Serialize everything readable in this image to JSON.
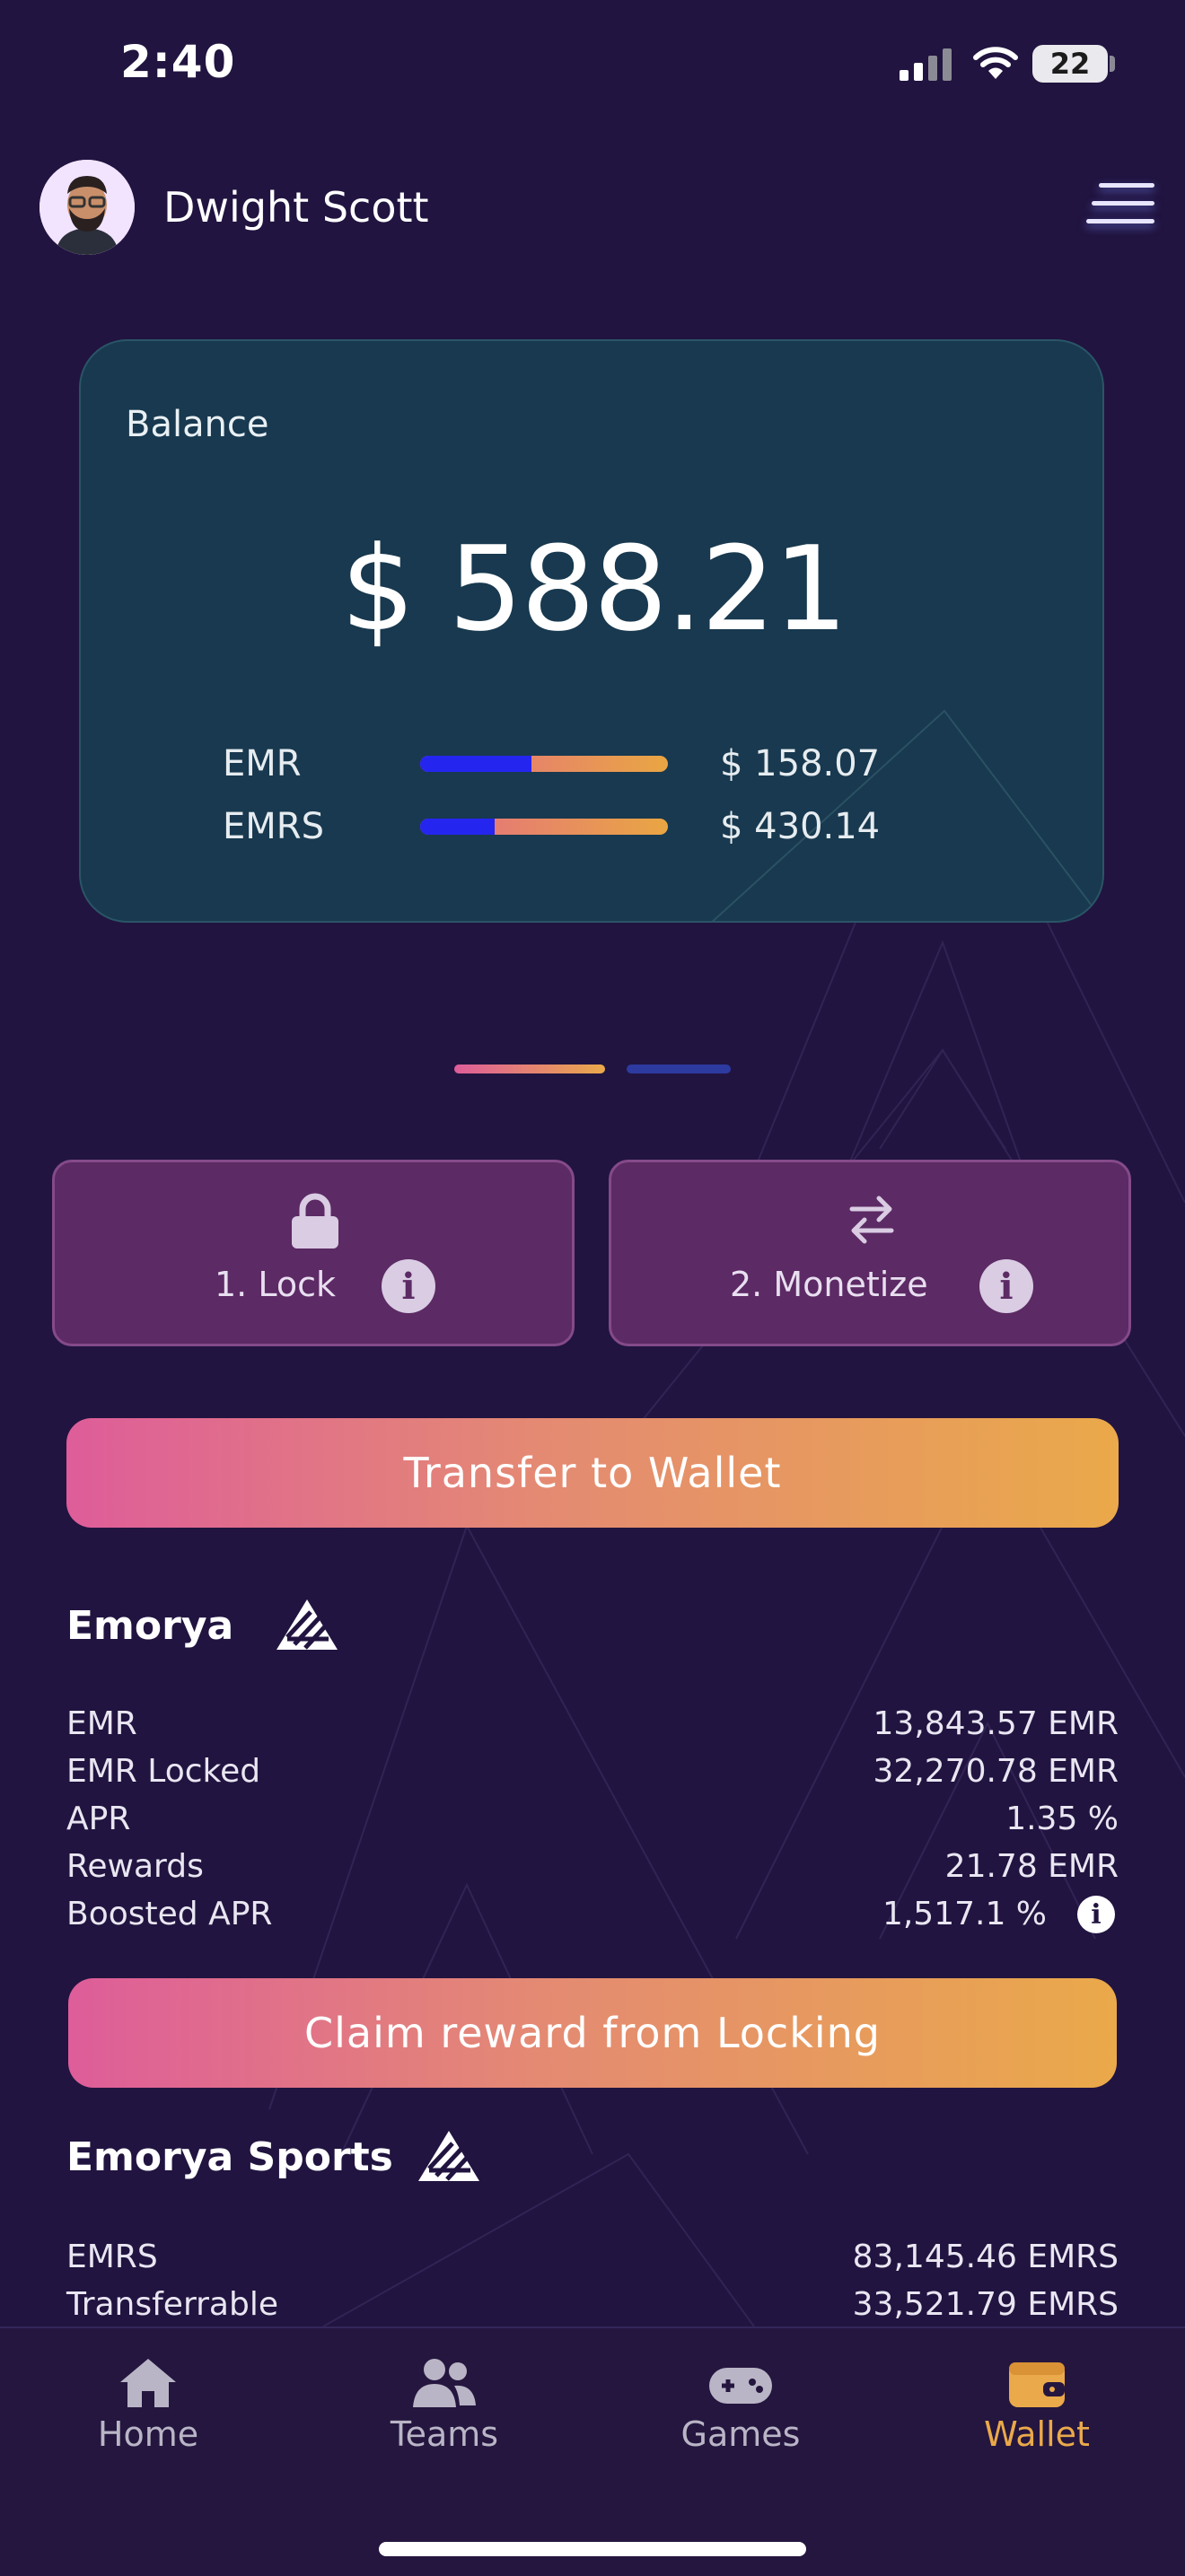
{
  "status_bar": {
    "time": "2:40",
    "battery": "22"
  },
  "header": {
    "user_name": "Dwight Scott"
  },
  "balance": {
    "title": "Balance",
    "amount": "$ 588.21",
    "assets": [
      {
        "label": "EMR",
        "value": "$ 158.07",
        "fill": 0.45
      },
      {
        "label": "EMRS",
        "value": "$ 430.14",
        "fill": 0.3
      }
    ]
  },
  "pager": {
    "count": 2,
    "active_index": 0
  },
  "actions": [
    {
      "label": "1. Lock",
      "icon": "lock-icon"
    },
    {
      "label": "2. Monetize",
      "icon": "swap-arrows-icon"
    }
  ],
  "transfer_button": "Transfer to Wallet",
  "emorya": {
    "title": "Emorya",
    "rows": [
      {
        "label": "EMR",
        "value": "13,843.57 EMR"
      },
      {
        "label": "EMR Locked",
        "value": "32,270.78 EMR"
      },
      {
        "label": "APR",
        "value": "1.35 %"
      },
      {
        "label": "Rewards",
        "value": "21.78 EMR"
      },
      {
        "label": "Boosted APR",
        "value": "1,517.1 %"
      }
    ]
  },
  "claim_button": "Claim reward from Locking",
  "emorya_sports": {
    "title": "Emorya Sports",
    "rows": [
      {
        "label": "EMRS",
        "value": "83,145.46 EMRS"
      },
      {
        "label": "Transferrable",
        "value": "33,521.79 EMRS"
      }
    ]
  },
  "nav": [
    {
      "label": "Home",
      "icon": "home-icon",
      "active": false
    },
    {
      "label": "Teams",
      "icon": "teams-icon",
      "active": false
    },
    {
      "label": "Games",
      "icon": "gamepad-icon",
      "active": false
    },
    {
      "label": "Wallet",
      "icon": "wallet-icon",
      "active": true
    }
  ],
  "colors": {
    "background": "#211440",
    "card": "#18394f",
    "accent_pink": "#de5d9a",
    "accent_orange": "#eaa94a",
    "action_box": "#5c2a64",
    "bar_blue": "#2525f0",
    "active_nav": "#eaa94a"
  }
}
